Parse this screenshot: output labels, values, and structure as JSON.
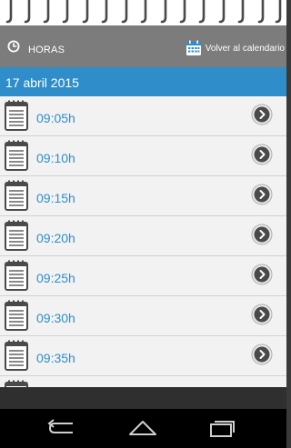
{
  "header": {
    "title": "HORAS",
    "back_to_calendar": "Volver al calendario"
  },
  "date_bar": {
    "date": "17 abril 2015"
  },
  "slots": [
    {
      "time": "09:05h"
    },
    {
      "time": "09:10h"
    },
    {
      "time": "09:15h"
    },
    {
      "time": "09:20h"
    },
    {
      "time": "09:25h"
    },
    {
      "time": "09:30h"
    },
    {
      "time": "09:35h"
    },
    {
      "time": ""
    }
  ],
  "colors": {
    "accent": "#2f8ec9",
    "header_bg": "#7c7c7c",
    "list_bg": "#f2f2f2",
    "nav_bg": "#000000"
  },
  "icons": {
    "header": "clock-icon",
    "calendar_button": "calendar-icon",
    "row_leading": "notepad-icon",
    "row_trailing": "chevron-right-circle-icon",
    "nav": [
      "back-icon",
      "home-icon",
      "recents-icon"
    ]
  }
}
